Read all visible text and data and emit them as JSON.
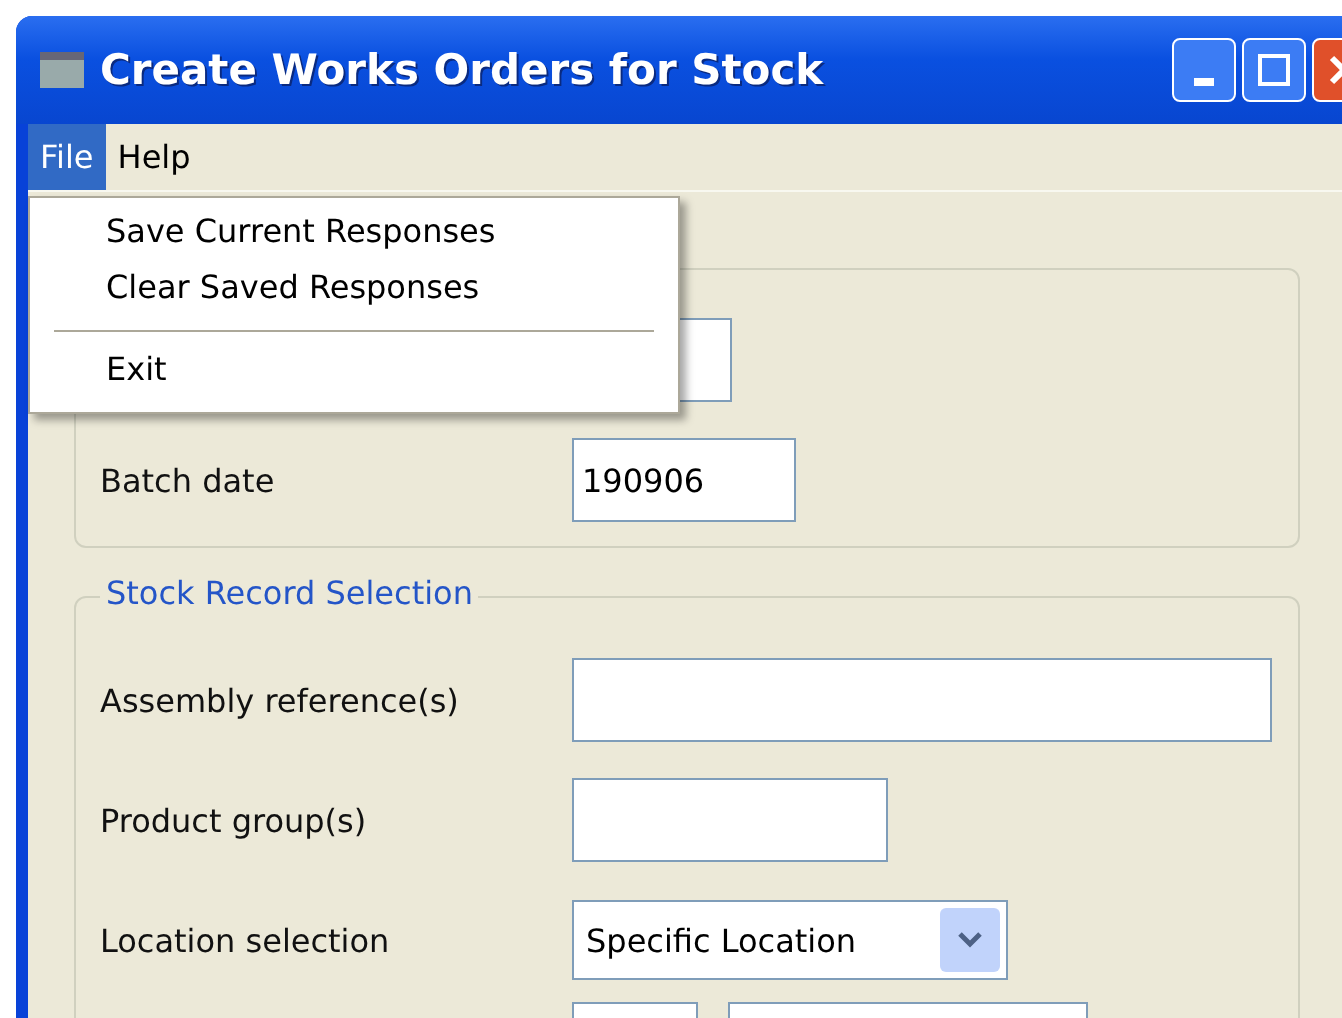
{
  "window": {
    "title": "Create Works Orders for Stock"
  },
  "menu_bar": [
    {
      "label": "File",
      "selected": true
    },
    {
      "label": "Help",
      "selected": false
    }
  ],
  "open_menu": {
    "items": [
      {
        "kind": "item",
        "label": "Save Current Responses"
      },
      {
        "kind": "item",
        "label": "Clear Saved Responses"
      },
      {
        "kind": "separator"
      },
      {
        "kind": "item",
        "label": "Exit"
      }
    ]
  },
  "batch_group": {
    "fields": [
      {
        "label": "Batch date",
        "value": "190906"
      }
    ]
  },
  "stock_group": {
    "title": "Stock Record Selection",
    "fields": [
      {
        "kind": "text",
        "label": "Assembly reference(s)"
      },
      {
        "kind": "text",
        "label": "Product group(s)"
      },
      {
        "kind": "select",
        "label": "Location selection",
        "value": "Specific Location"
      }
    ]
  }
}
